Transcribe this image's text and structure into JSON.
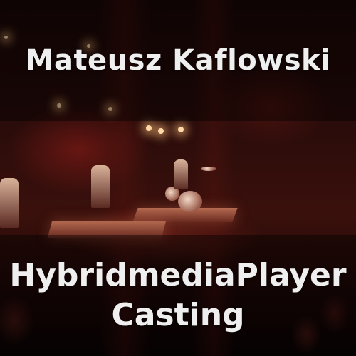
{
  "cover": {
    "author": "Mateusz Kaflowski",
    "title_line1": "HybridmediaPlayer",
    "title_line2": "Casting"
  }
}
